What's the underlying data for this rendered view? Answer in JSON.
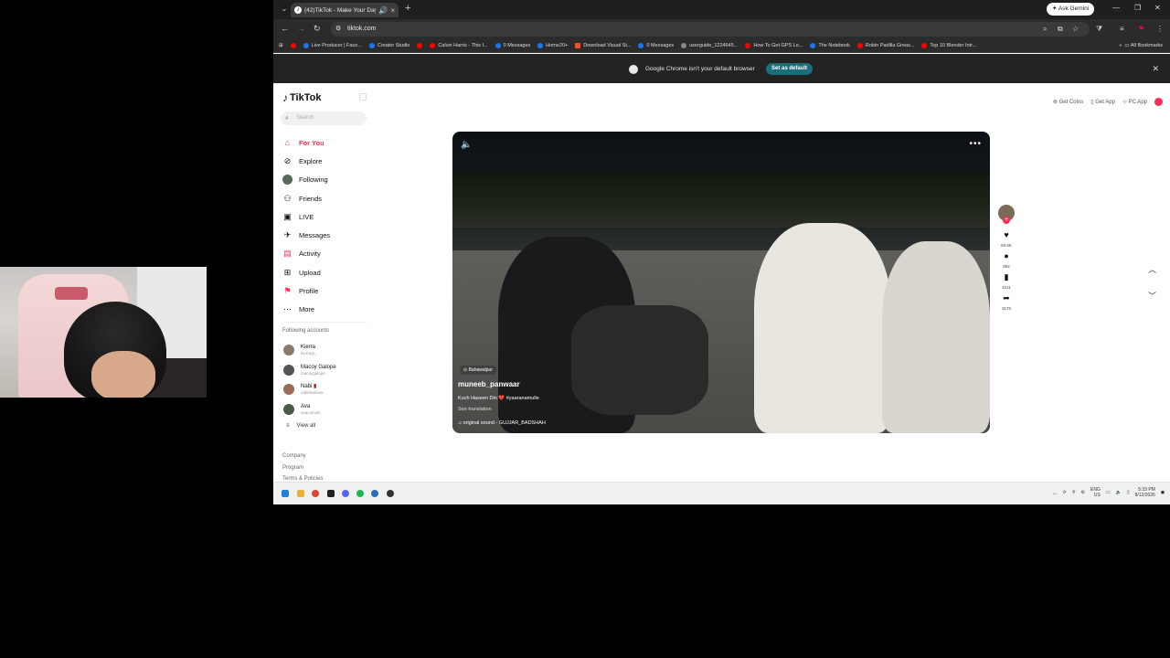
{
  "browser": {
    "tab_title": "(42)TikTok - Make Your Day",
    "new_tab_label": "+",
    "gemini_label": "Ask Gemini",
    "url": "tiktok.com",
    "bookmarks": [
      {
        "label": "Live Producer | Face...",
        "color": "#1877f2"
      },
      {
        "label": "Creator Studio",
        "color": "#1877f2"
      },
      {
        "label": "Calvin Harris - This I...",
        "color": "#ff0000"
      },
      {
        "label": "0 Messages",
        "color": "#1877f2"
      },
      {
        "label": "Home20+",
        "color": "#1877f2"
      },
      {
        "label": "Download Visual St...",
        "color": "#f25022"
      },
      {
        "label": "0 Messages",
        "color": "#1877f2"
      },
      {
        "label": "userguide_1224645...",
        "color": "#888888"
      },
      {
        "label": "How To Get GPS Lo...",
        "color": "#ff0000"
      },
      {
        "label": "The Notebook",
        "color": "#1877f2"
      },
      {
        "label": "Robin Padilla Greas...",
        "color": "#ff0000"
      },
      {
        "label": "Top 10 Blender Intr...",
        "color": "#ff0000"
      }
    ],
    "all_bookmarks_label": "All Bookmarks",
    "infobar_message": "Google Chrome isn't your default browser",
    "infobar_button": "Set as default"
  },
  "tiktok": {
    "logo": "TikTok",
    "search_placeholder": "Search",
    "nav": [
      {
        "label": "For You",
        "icon": "home-icon",
        "active": true
      },
      {
        "label": "Explore",
        "icon": "compass-icon"
      },
      {
        "label": "Following",
        "icon": "following-icon"
      },
      {
        "label": "Friends",
        "icon": "friends-icon"
      },
      {
        "label": "LIVE",
        "icon": "live-icon"
      },
      {
        "label": "Messages",
        "icon": "messages-icon"
      },
      {
        "label": "Activity",
        "icon": "activity-icon"
      },
      {
        "label": "Upload",
        "icon": "upload-icon"
      },
      {
        "label": "Profile",
        "icon": "profile-icon"
      },
      {
        "label": "More",
        "icon": "more-icon"
      }
    ],
    "following_header": "Following accounts",
    "accounts": [
      {
        "name": "Kierra",
        "handle": "kierragc_"
      },
      {
        "name": "Macoy Galope",
        "handle": "macoygalope"
      },
      {
        "name": "Nabi",
        "handle": "nabimanasa"
      },
      {
        "name": "Ava",
        "handle": "avacuevas"
      }
    ],
    "view_all": "View all",
    "footer_links": [
      "Company",
      "Program",
      "Terms & Policies"
    ],
    "top_right": {
      "coins": "Get Coins",
      "app": "Get App",
      "pc": "PC App"
    },
    "video": {
      "location": "Bahawalpur",
      "username": "muneeb_panwaar",
      "caption": "Kuch Haseen Din ❤️ #yaaranamulle",
      "see_translation": "See translation",
      "sound": "original sound - GUJJAR_BADSHAH"
    },
    "actions": {
      "likes": "60.6K",
      "comments": "882",
      "saves": "2211",
      "shares": "3176"
    }
  },
  "taskbar": {
    "lang": "ENG",
    "region": "US",
    "time": "5:33 PM",
    "date": "8/12/2026"
  }
}
